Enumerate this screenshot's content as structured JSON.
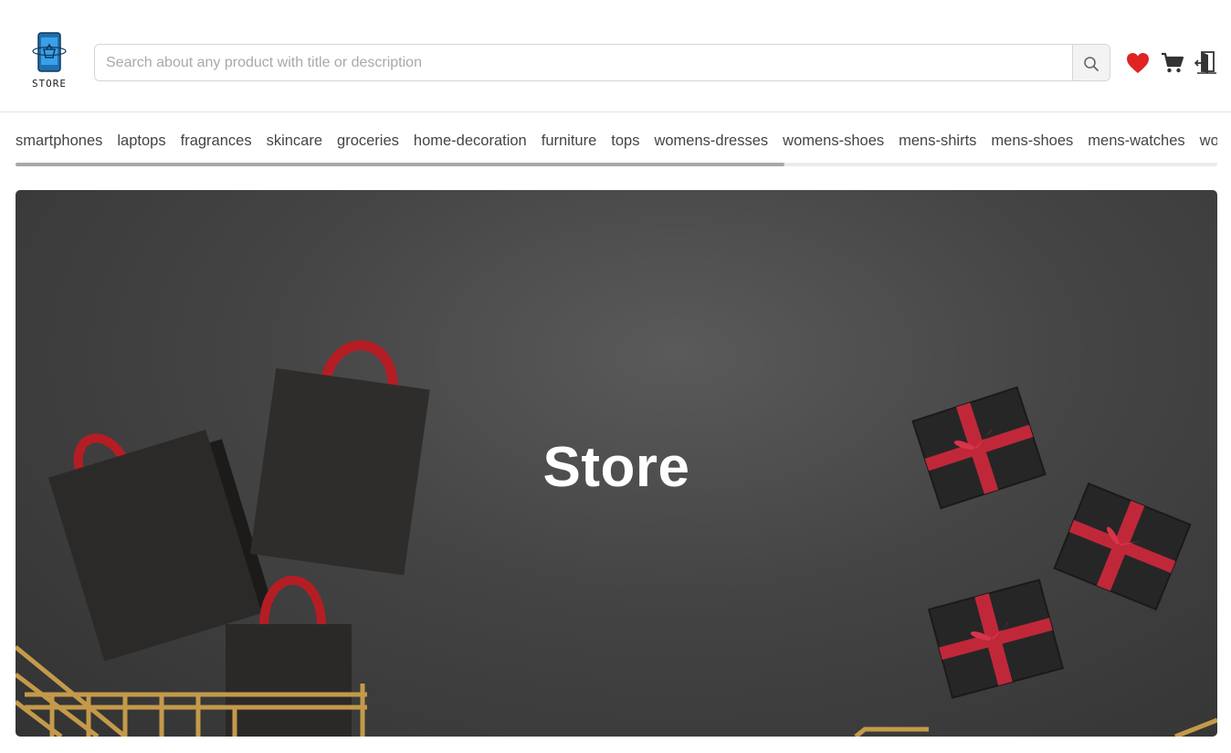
{
  "brand": {
    "logo_text": "STORE"
  },
  "search": {
    "placeholder": "Search about any product with title or description"
  },
  "header_icons": [
    "heart-icon",
    "cart-icon",
    "logout-icon"
  ],
  "categories": [
    "smartphones",
    "laptops",
    "fragrances",
    "skincare",
    "groceries",
    "home-decoration",
    "furniture",
    "tops",
    "womens-dresses",
    "womens-shoes",
    "mens-shirts",
    "mens-shoes",
    "mens-watches",
    "womens-watches"
  ],
  "category_scroll_position": 0.64,
  "hero": {
    "title": "Store"
  },
  "colors": {
    "heart": "#e02323",
    "icons": "#333333",
    "ribbon": "#c8102e"
  }
}
